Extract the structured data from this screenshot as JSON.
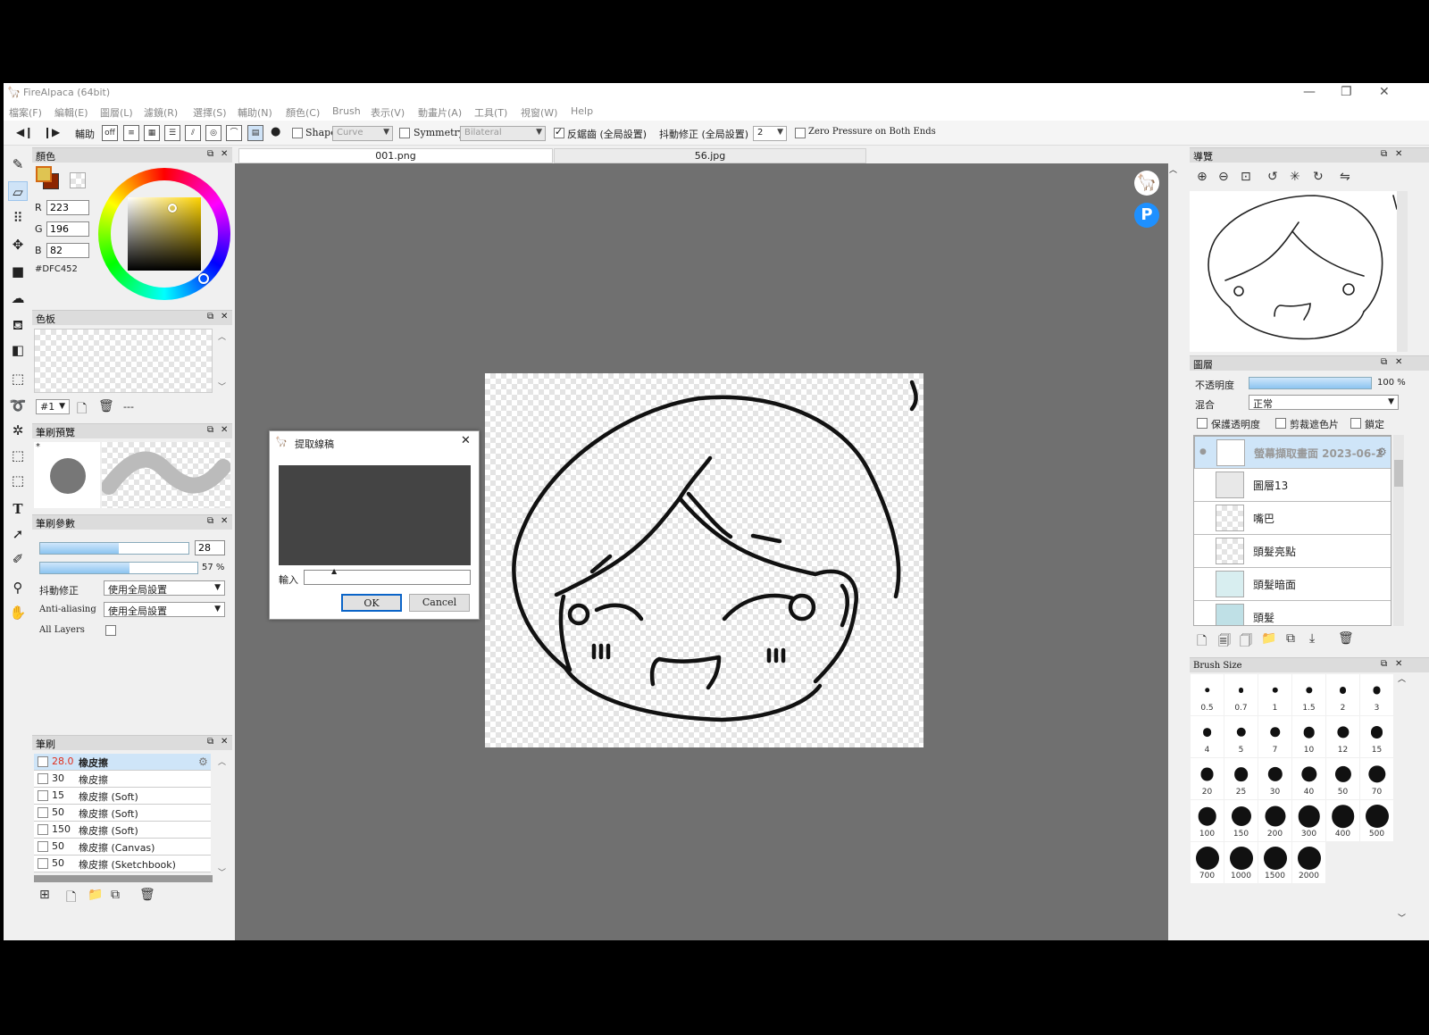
{
  "app": {
    "title": "FireAlpaca (64bit)"
  },
  "menu": [
    "檔案(F)",
    "編輯(E)",
    "圖層(L)",
    "濾鏡(R)",
    "選擇(S)",
    "輔助(N)",
    "顏色(C)",
    "Brush",
    "表示(V)",
    "動畫片(A)",
    "工具(T)",
    "視窗(W)",
    "Help"
  ],
  "toolbar": {
    "assist_label": "輔助",
    "off_label": "off",
    "shape_label": "Shape",
    "shape_value": "Curve",
    "symmetry_label": "Symmetry",
    "symmetry_value": "Bilateral",
    "antialias_label": "反鋸齒 (全局設置)",
    "correction_label": "抖動修正 (全局設置)",
    "correction_value": "2",
    "zero_pressure_label": "Zero Pressure on Both Ends"
  },
  "color_panel": {
    "title": "顏色",
    "r_label": "R",
    "r_value": "223",
    "g_label": "G",
    "g_value": "196",
    "b_label": "B",
    "b_value": "82",
    "hex": "#DFC452",
    "primary_color": "#DFC452",
    "secondary_color": "#8B2500"
  },
  "palette_panel": {
    "title": "色板",
    "selector": "#1",
    "more": "---"
  },
  "brush_preview_panel": {
    "title": "筆刷預覽",
    "marker": "*"
  },
  "brush_params_panel": {
    "title": "筆刷參數",
    "size_value": "28",
    "size_fill": 0.53,
    "opacity_value": "57",
    "opacity_unit": "%",
    "opacity_fill": 0.57,
    "correction_label": "抖動修正",
    "correction_value": "使用全局設置",
    "antialias_label": "Anti-aliasing",
    "antialias_value": "使用全局設置",
    "all_layers_label": "All Layers"
  },
  "brush_panel": {
    "title": "筆刷",
    "items": [
      {
        "size": "28.0",
        "name": "橡皮擦"
      },
      {
        "size": "30",
        "name": "橡皮擦"
      },
      {
        "size": "15",
        "name": "橡皮擦 (Soft)"
      },
      {
        "size": "50",
        "name": "橡皮擦 (Soft)"
      },
      {
        "size": "150",
        "name": "橡皮擦 (Soft)"
      },
      {
        "size": "50",
        "name": "橡皮擦 (Canvas)"
      },
      {
        "size": "50",
        "name": "橡皮擦 (Sketchbook)"
      }
    ]
  },
  "tabs": [
    {
      "label": "001.png"
    },
    {
      "label": "56.jpg"
    }
  ],
  "dialog": {
    "title": "提取線稿",
    "input_label": "輸入",
    "ok": "OK",
    "cancel": "Cancel",
    "close": "✕"
  },
  "navigator_panel": {
    "title": "導覽"
  },
  "layers_panel": {
    "title": "圖層",
    "opacity_label": "不透明度",
    "opacity_value": "100 %",
    "opacity_fill": 1.0,
    "blend_label": "混合",
    "blend_value": "正常",
    "protect_label": "保護透明度",
    "clip_label": "剪裁遮色片",
    "lock_label": "鎖定",
    "layers": [
      {
        "name": "螢幕擷取畫面 2023-06-2"
      },
      {
        "name": "圖層13"
      },
      {
        "name": "嘴巴"
      },
      {
        "name": "頭髮亮點"
      },
      {
        "name": "頭髮暗面"
      },
      {
        "name": "頭髮"
      }
    ]
  },
  "brush_size_panel": {
    "title": "Brush Size",
    "sizes": [
      "0.5",
      "0.7",
      "1",
      "1.5",
      "2",
      "3",
      "4",
      "5",
      "7",
      "10",
      "12",
      "15",
      "20",
      "25",
      "30",
      "40",
      "50",
      "70",
      "100",
      "150",
      "200",
      "300",
      "400",
      "500",
      "700",
      "1000",
      "1500",
      "2000"
    ]
  },
  "icons": {
    "menu_app": "alpaca-icon",
    "tab_close": "close-icon"
  }
}
